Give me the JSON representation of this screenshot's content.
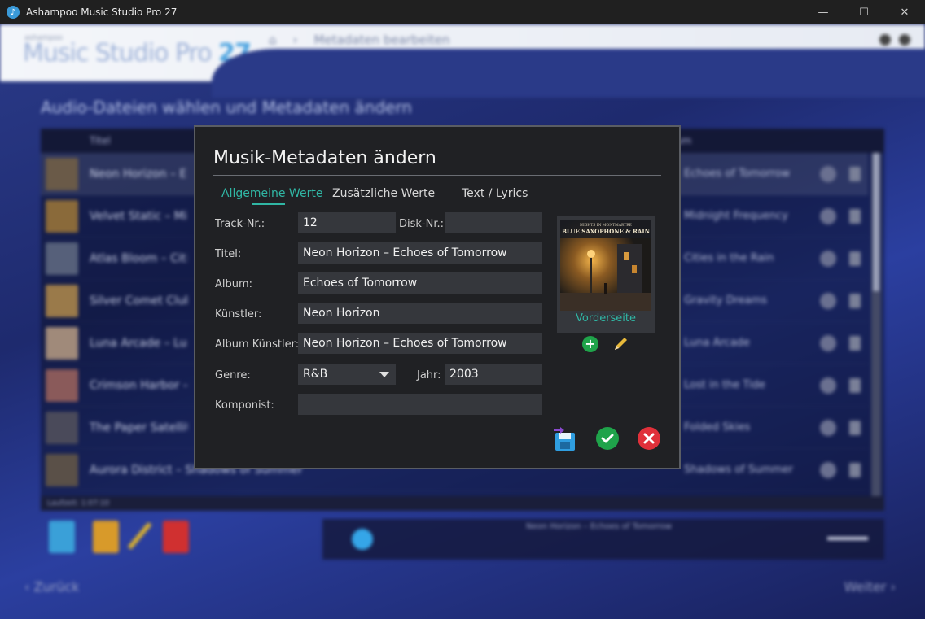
{
  "window": {
    "title": "Ashampoo Music Studio Pro 27",
    "minimize_glyph": "—",
    "maximize_glyph": "☐",
    "close_glyph": "✕"
  },
  "background": {
    "logo_small": "ashampoo",
    "logo_text": "Music Studio Pro",
    "logo_number": "27",
    "breadcrumb_page": "Metadaten bearbeiten",
    "section_title": "Audio-Dateien wählen und Metadaten ändern",
    "list_header_title": "Titel",
    "list_header_album": "Album",
    "rows": [
      {
        "title": "Neon Horizon – Echoes of Tomorrow",
        "album": "Echoes of Tomorrow"
      },
      {
        "title": "Velvet Static – Midnight Frequency",
        "album": "Midnight Frequency"
      },
      {
        "title": "Atlas Bloom – Cities in the Rain",
        "album": "Cities in the Rain"
      },
      {
        "title": "Silver Comet Club – Gravity Dreams",
        "album": "Gravity Dreams"
      },
      {
        "title": "Luna Arcade – Luna Arcade",
        "album": "Luna Arcade"
      },
      {
        "title": "Crimson Harbor – Lost in the Tide",
        "album": "Lost in the Tide"
      },
      {
        "title": "The Paper Satellites – Folded Skies",
        "album": "Folded Skies"
      },
      {
        "title": "Aurora District – Shadows of Summer",
        "album": "Shadows of Summer"
      }
    ],
    "runtime": "Laufzeit: 1:07:10",
    "player_title": "Neon Horizon – Echoes of Tomorrow",
    "back_label": "Zurück",
    "next_label": "Weiter"
  },
  "dialog": {
    "title": "Musik-Metadaten ändern",
    "tabs": [
      "Allgemeine Werte",
      "Zusätzliche Werte",
      "Text / Lyrics"
    ],
    "active_tab": 0,
    "fields": {
      "track_label": "Track-Nr.:",
      "track_value": "12",
      "disk_label": "Disk-Nr.:",
      "disk_value": "",
      "title_label": "Titel:",
      "title_value": "Neon Horizon – Echoes of Tomorrow",
      "album_label": "Album:",
      "album_value": "Echoes of Tomorrow",
      "artist_label": "Künstler:",
      "artist_value": "Neon Horizon",
      "album_artist_label": "Album Künstler:",
      "album_artist_value": "Neon Horizon – Echoes of Tomorrow",
      "genre_label": "Genre:",
      "genre_value": "R&B",
      "year_label": "Jahr:",
      "year_value": "2003",
      "composer_label": "Komponist:",
      "composer_value": ""
    },
    "cover": {
      "caption": "Vorderseite",
      "art_title": "BLUE SAXOPHONE & RAIN",
      "art_subtitle": "NIGHTS IN MONTMARTRE"
    },
    "icons": {
      "add": "add-cover-icon",
      "edit": "pencil-icon",
      "save": "save-icon",
      "ok": "checkmark-icon",
      "cancel": "close-icon"
    },
    "colors": {
      "accent": "#30b6a4",
      "ok": "#1fa34a",
      "cancel": "#e0303a"
    }
  }
}
